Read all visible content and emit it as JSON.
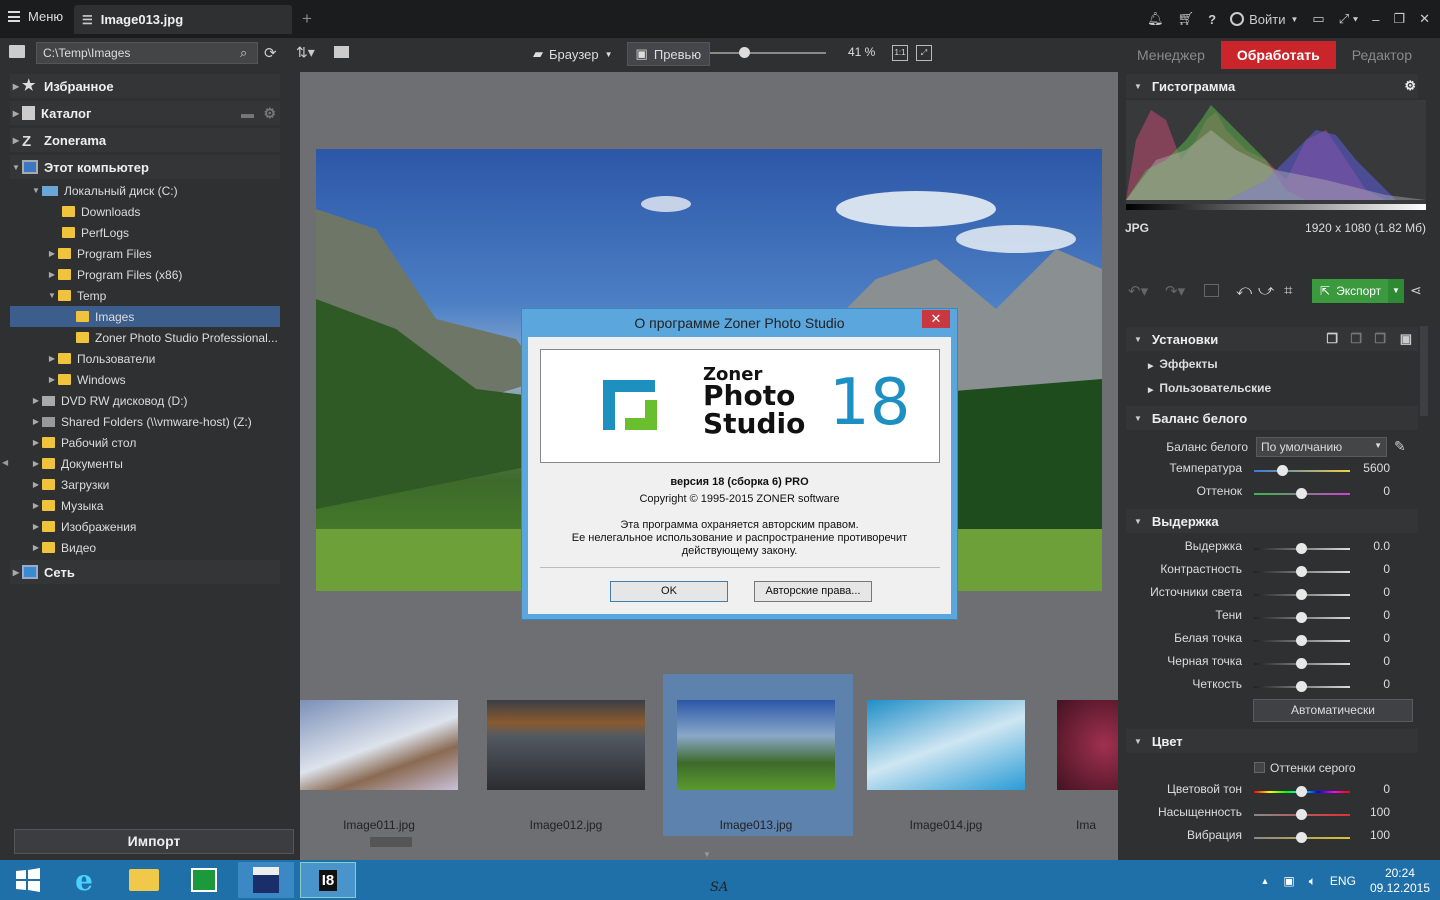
{
  "titlebar": {
    "menu_label": "Меню",
    "tab_title": "Image013.jpg",
    "login_label": "Войти"
  },
  "toolbar": {
    "path": "C:\\Temp\\Images",
    "browser_label": "Браузер",
    "preview_label": "Превью",
    "zoom": "41 %",
    "ratio_label": "1:1",
    "zoom_level": 0.3
  },
  "mode_tabs": [
    "Менеджер",
    "Обработать",
    "Редактор"
  ],
  "navigator": {
    "favorites": "Избранное",
    "catalog": "Каталог",
    "zonerama": "Zonerama",
    "this_pc": "Этот компьютер",
    "items": [
      {
        "label": "Локальный диск (C:)"
      },
      {
        "label": "Downloads"
      },
      {
        "label": "PerfLogs"
      },
      {
        "label": "Program Files"
      },
      {
        "label": "Program Files (x86)"
      },
      {
        "label": "Temp"
      },
      {
        "label": "Images"
      },
      {
        "label": "Zoner Photo Studio Professional..."
      },
      {
        "label": "Пользователи"
      },
      {
        "label": "Windows"
      },
      {
        "label": "DVD RW дисковод (D:)"
      },
      {
        "label": "Shared Folders (\\\\vmware-host) (Z:)"
      },
      {
        "label": "Рабочий стол"
      },
      {
        "label": "Документы"
      },
      {
        "label": "Загрузки"
      },
      {
        "label": "Музыка"
      },
      {
        "label": "Изображения"
      },
      {
        "label": "Видео"
      }
    ],
    "network": "Сеть",
    "import_label": "Импорт"
  },
  "dialog": {
    "title": "О программе Zoner Photo Studio",
    "logo_line1": "Zoner",
    "logo_line2": "Photo",
    "logo_line3": "Studio",
    "logo_version": "18",
    "version": "версия 18 (сборка 6) PRO",
    "copyright": "Copyright © 1995-2015 ZONER software",
    "legal1": "Эта программа охраняется авторским правом.",
    "legal2": "Ее нелегальное использование и распространение противоречит",
    "legal3": "действующему закону.",
    "ok_label": "OK",
    "rights_label": "Авторские права..."
  },
  "filmstrip": [
    {
      "name": "Image011.jpg"
    },
    {
      "name": "Image012.jpg"
    },
    {
      "name": "Image013.jpg"
    },
    {
      "name": "Image014.jpg"
    },
    {
      "name": "Ima"
    }
  ],
  "right_panel": {
    "histogram_title": "Гистограмма",
    "format": "JPG",
    "dimensions": "1920 x 1080 (1.82 Мб)",
    "export_label": "Экспорт",
    "settings_title": "Установки",
    "effects_label": "Эффекты",
    "user_label": "Пользовательские",
    "wb_title": "Баланс белого",
    "wb_label": "Баланс белого",
    "wb_value": "По умолчанию",
    "wb_rows": [
      {
        "label": "Температура",
        "value": "5600"
      },
      {
        "label": "Оттенок",
        "value": "0"
      }
    ],
    "exposure_title": "Выдержка",
    "exposure_rows": [
      {
        "label": "Выдержка",
        "value": "0.0"
      },
      {
        "label": "Контрастность",
        "value": "0"
      },
      {
        "label": "Источники света",
        "value": "0"
      },
      {
        "label": "Тени",
        "value": "0"
      },
      {
        "label": "Белая точка",
        "value": "0"
      },
      {
        "label": "Черная точка",
        "value": "0"
      },
      {
        "label": "Четкость",
        "value": "0"
      }
    ],
    "auto_label": "Автоматически",
    "color_title": "Цвет",
    "grayscale_label": "Оттенки серого",
    "color_rows": [
      {
        "label": "Цветовой тон",
        "value": "0"
      },
      {
        "label": "Насыщенность",
        "value": "100"
      },
      {
        "label": "Вибрация",
        "value": "100"
      }
    ]
  },
  "taskbar": {
    "lang": "ENG",
    "time": "20:24",
    "date": "09.12.2015",
    "center_text": "SA"
  }
}
